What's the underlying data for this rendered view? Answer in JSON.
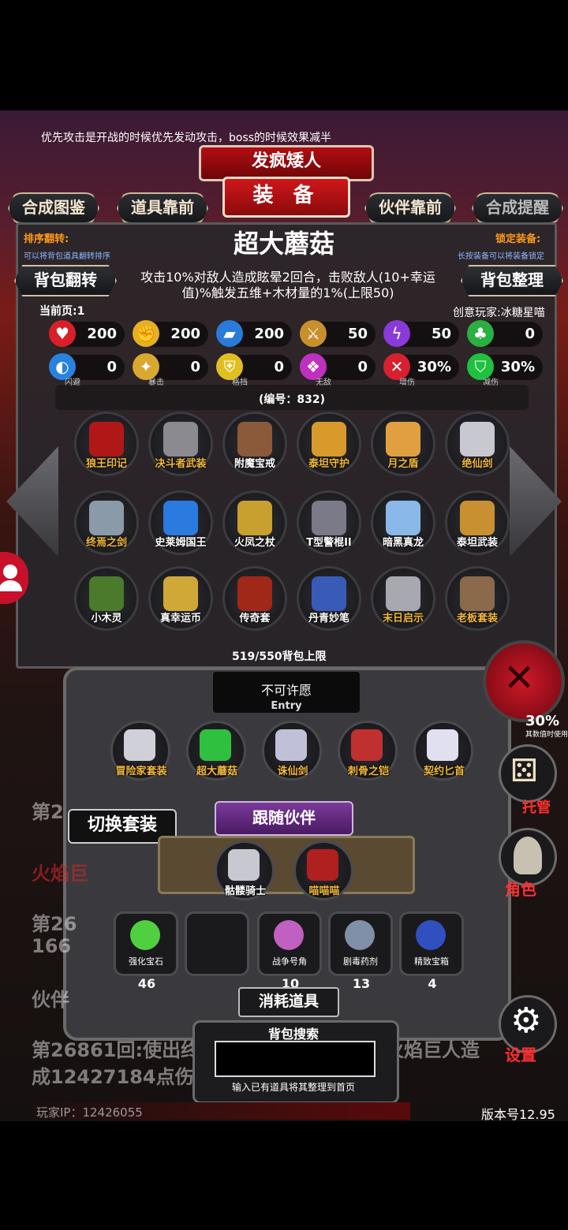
{
  "tip": "优先攻击是开战的时候优先发动攻击，boss的时候效果减半",
  "banner": {
    "name": "发疯矮人",
    "title": "装 备"
  },
  "tabs": {
    "left1": "合成图鉴",
    "left2": "道具靠前",
    "right1": "伙伴靠前",
    "right2": "合成提醒"
  },
  "sort": {
    "label": "排序翻转:",
    "hint": "可以将背包道具翻转排序"
  },
  "lock": {
    "label": "锁定装备:",
    "hint": "长按装备可以将装备锁定"
  },
  "side": {
    "flip": "背包翻转",
    "tidy": "背包整理"
  },
  "item": {
    "title": "超大蘑菇",
    "desc": "攻击10%对敌人造成眩晕2回合，击败敌人(10+幸运值)%触发五维+木材量的1%(上限50)",
    "code": "(编号：832)"
  },
  "page": "当前页:1",
  "creator": "创意玩家:冰糖星喵",
  "stats_row1": [
    {
      "icon": "heart-icon",
      "value": "200",
      "color": "#d81f2a",
      "glyph": "♥"
    },
    {
      "icon": "strength-icon",
      "value": "200",
      "color": "#e6b020",
      "glyph": "✊"
    },
    {
      "icon": "armor-icon",
      "value": "200",
      "color": "#2a7ad8",
      "glyph": "▰"
    },
    {
      "icon": "sword-icon",
      "value": "50",
      "color": "#c8902c",
      "glyph": "⚔"
    },
    {
      "icon": "lightning-icon",
      "value": "50",
      "color": "#8a3ad8",
      "glyph": "ϟ"
    },
    {
      "icon": "clover-icon",
      "value": "0",
      "color": "#2ab040",
      "glyph": "♣"
    }
  ],
  "stats_row2": [
    {
      "icon": "dodge-icon",
      "value": "0",
      "cap": "闪避",
      "color": "#2a82e0",
      "glyph": "◐"
    },
    {
      "icon": "crit-icon",
      "value": "0",
      "cap": "暴击",
      "color": "#d8a830",
      "glyph": "✦"
    },
    {
      "icon": "block-icon",
      "value": "0",
      "cap": "格挡",
      "color": "#e0c020",
      "glyph": "⛨"
    },
    {
      "icon": "invincible-icon",
      "value": "0",
      "cap": "无敌",
      "color": "#c030c0",
      "glyph": "❖"
    },
    {
      "icon": "damage-up-icon",
      "value": "30%",
      "cap": "增伤",
      "color": "#d82030",
      "glyph": "✕"
    },
    {
      "icon": "damage-down-icon",
      "value": "30%",
      "cap": "减伤",
      "color": "#20c040",
      "glyph": "⛉"
    }
  ],
  "inventory": [
    {
      "name": "狼王印记",
      "color": "#b01818"
    },
    {
      "name": "决斗者武装",
      "color": "#8a8a90"
    },
    {
      "name": "附魔宝戒",
      "color": "#8a5a3a",
      "white": true
    },
    {
      "name": "泰坦守护",
      "color": "#d89a2a"
    },
    {
      "name": "月之盾",
      "color": "#e0a040"
    },
    {
      "name": "绝仙剑",
      "color": "#c8c8d0"
    },
    {
      "name": "终焉之剑",
      "color": "#8a9aa8"
    },
    {
      "name": "史莱姆国王",
      "color": "#2a7ae0",
      "white": true
    },
    {
      "name": "火凤之杖",
      "color": "#c8a030",
      "white": true
    },
    {
      "name": "T型警棍II",
      "color": "#7a7a88",
      "white": true
    },
    {
      "name": "暗黑真龙",
      "color": "#8ab8e8",
      "white": true
    },
    {
      "name": "泰坦武装",
      "color": "#c89030",
      "white": true
    },
    {
      "name": "小木灵",
      "color": "#4a7a2a",
      "white": true
    },
    {
      "name": "真幸运币",
      "color": "#d0a838",
      "white": true
    },
    {
      "name": "传奇套",
      "color": "#a02818",
      "white": true
    },
    {
      "name": "丹青妙笔",
      "color": "#3a5ab8",
      "white": true
    },
    {
      "name": "末日启示",
      "color": "#a8a8b0"
    },
    {
      "name": "老板套装",
      "color": "#8a6a4a"
    }
  ],
  "capacity": "519/550背包上限",
  "wish": {
    "title": "不可许愿",
    "sub": "Entry"
  },
  "equipped": [
    {
      "name": "冒险家套装",
      "color": "#d0d0d8"
    },
    {
      "name": "超大蘑菇",
      "color": "#30c040"
    },
    {
      "name": "诛仙剑",
      "color": "#c0c0d8"
    },
    {
      "name": "刺骨之铠",
      "color": "#c03030"
    },
    {
      "name": "契约匕首",
      "color": "#e0e0f0"
    }
  ],
  "switch_set": "切换套装",
  "follow": "跟随伙伴",
  "partners": [
    {
      "name": "骷髅骑士",
      "color": "#c8c8d0",
      "white": true
    },
    {
      "name": "喵喵喵",
      "color": "#b02020"
    }
  ],
  "consumables": [
    {
      "name": "强化宝石",
      "count": "46",
      "color": "#50d040"
    },
    {
      "name": "",
      "count": "",
      "color": "#2a2a2c"
    },
    {
      "name": "战争号角",
      "count": "10",
      "color": "#c060c0"
    },
    {
      "name": "剧毒药剂",
      "count": "13",
      "color": "#8090a8"
    },
    {
      "name": "精致宝箱",
      "count": "4",
      "color": "#3050c0"
    }
  ],
  "consume_label": "消耗道具",
  "search": {
    "label": "背包搜索",
    "hint": "输入已有道具将其整理到首页",
    "value": ""
  },
  "right_side": {
    "dice": "托管",
    "role": "角色",
    "settings": "设置",
    "percent": "30%",
    "percent_hint": "其数值时使用"
  },
  "log": {
    "l1": "第2",
    "l2": "火焰巨",
    "l3": "第26",
    "l4": "166",
    "l5": "伙伴",
    "l6": "第26861回:使出终",
    "l6b": "火焰巨人造",
    "l7": "成12427184点伤害"
  },
  "player_ip": "玩家IP：12426055",
  "version": "版本号12.95"
}
